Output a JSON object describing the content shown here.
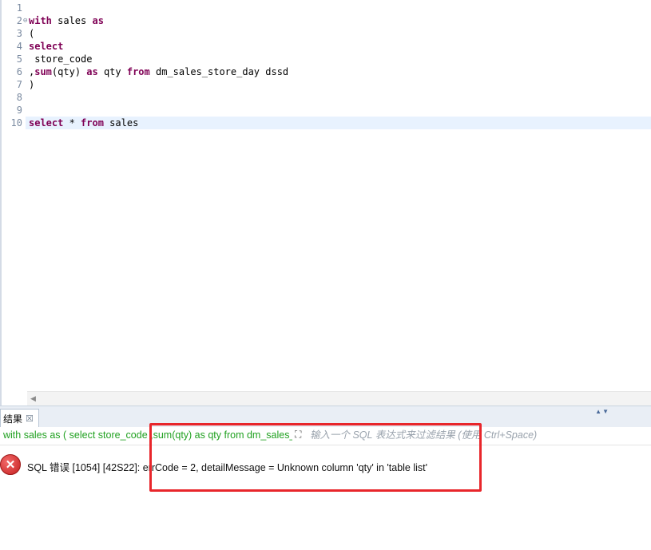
{
  "editor": {
    "lines": [
      {
        "num": "1",
        "fold": "",
        "tokens": []
      },
      {
        "num": "2",
        "fold": "⊖",
        "tokens": [
          {
            "t": "with",
            "kw": true
          },
          {
            "t": " sales ",
            "kw": false
          },
          {
            "t": "as",
            "kw": true
          }
        ]
      },
      {
        "num": "3",
        "fold": "",
        "tokens": [
          {
            "t": "(",
            "kw": false
          }
        ]
      },
      {
        "num": "4",
        "fold": "",
        "tokens": [
          {
            "t": "select",
            "kw": true
          }
        ]
      },
      {
        "num": "5",
        "fold": "",
        "tokens": [
          {
            "t": " store_code",
            "kw": false
          }
        ]
      },
      {
        "num": "6",
        "fold": "",
        "tokens": [
          {
            "t": ",",
            "kw": false
          },
          {
            "t": "sum",
            "kw": true
          },
          {
            "t": "(qty) ",
            "kw": false
          },
          {
            "t": "as",
            "kw": true
          },
          {
            "t": " qty ",
            "kw": false
          },
          {
            "t": "from",
            "kw": true
          },
          {
            "t": " dm_sales_store_day dssd",
            "kw": false
          }
        ]
      },
      {
        "num": "7",
        "fold": "",
        "tokens": [
          {
            "t": ")",
            "kw": false
          }
        ]
      },
      {
        "num": "8",
        "fold": "",
        "tokens": []
      },
      {
        "num": "9",
        "fold": "",
        "tokens": []
      },
      {
        "num": "10",
        "fold": "",
        "tokens": [
          {
            "t": "select",
            "kw": true
          },
          {
            "t": " * ",
            "kw": false
          },
          {
            "t": "from",
            "kw": true
          },
          {
            "t": " sales",
            "kw": false
          }
        ]
      }
    ],
    "current_line": 10
  },
  "results": {
    "tab_label": "结果",
    "tab_close": "☒",
    "panel_controls": "▲▼",
    "query_text": "with sales as ( select store_code ,sum(qty) as qty from dm_sales_store_day dssd ) select * from sales",
    "filter_placeholder": "输入一个 SQL 表达式来过滤结果 (使用 Ctrl+Space)",
    "error_icon": "✕",
    "error_message": "SQL 错误 [1054] [42S22]: errCode = 2, detailMessage = Unknown column 'qty' in 'table list'"
  },
  "colors": {
    "keyword": "#7f0055",
    "query_text": "#21a121",
    "current_line": "#e8f2fe",
    "highlight": "#e8262b"
  }
}
